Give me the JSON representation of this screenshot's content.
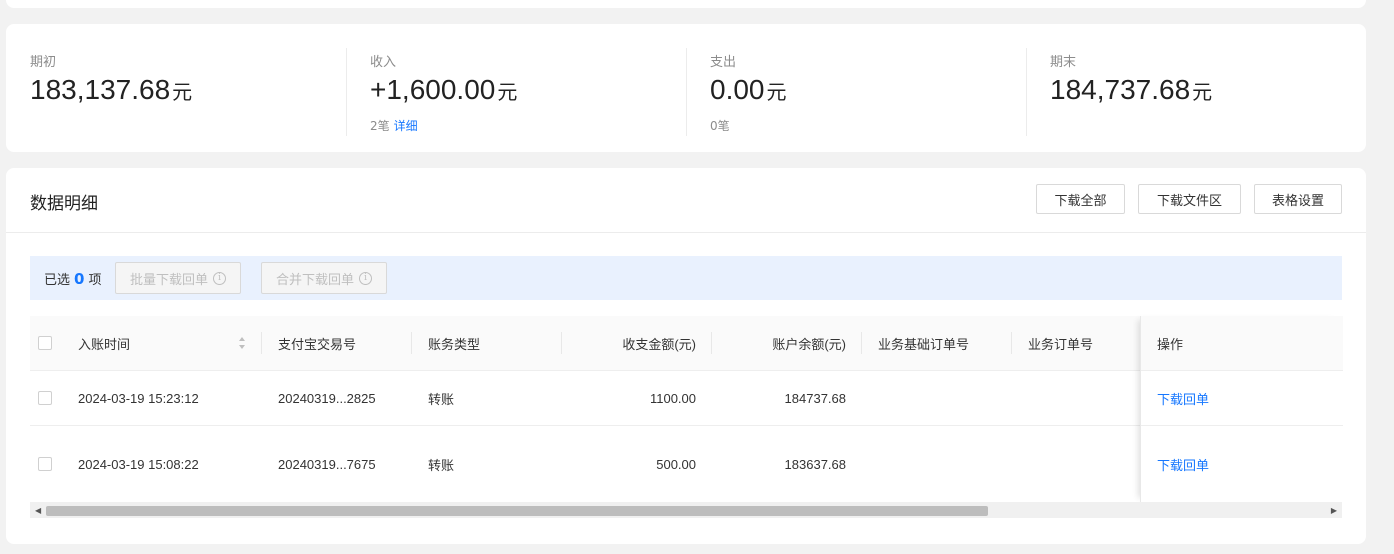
{
  "summary": {
    "opening": {
      "label": "期初",
      "value": "183,137.68",
      "unit": "元"
    },
    "income": {
      "label": "收入",
      "value": "+1,600.00",
      "unit": "元",
      "count": "2笔",
      "detail_link": "详细"
    },
    "expense": {
      "label": "支出",
      "value": "0.00",
      "unit": "元",
      "count": "0笔"
    },
    "closing": {
      "label": "期末",
      "value": "184,737.68",
      "unit": "元"
    }
  },
  "detail": {
    "title": "数据明细",
    "buttons": {
      "download_all": "下载全部",
      "download_files": "下载文件区",
      "table_settings": "表格设置"
    },
    "selection": {
      "prefix": "已选",
      "count": "0",
      "suffix": "项",
      "batch_download": "批量下载回单",
      "merge_download": "合并下载回单"
    },
    "columns": [
      "入账时间",
      "支付宝交易号",
      "账务类型",
      "收支金额(元)",
      "账户余额(元)",
      "业务基础订单号",
      "业务订单号",
      "操作"
    ],
    "rows": [
      {
        "time": "2024-03-19 15:23:12",
        "trade_no": "20240319...2825",
        "type": "转账",
        "amount": "1100.00",
        "balance": "184737.68",
        "base_order": "",
        "order": "",
        "action": "下载回单"
      },
      {
        "time": "2024-03-19 15:08:22",
        "trade_no": "20240319...7675",
        "type": "转账",
        "amount": "500.00",
        "balance": "183637.68",
        "base_order": "",
        "order": "",
        "action": "下载回单"
      }
    ]
  },
  "colors": {
    "accent": "#1677ff",
    "selection_bg": "#e9f1fe"
  },
  "icons": [
    "info-icon",
    "sort-icon",
    "scroll-left-arrow-icon",
    "scroll-right-arrow-icon"
  ]
}
